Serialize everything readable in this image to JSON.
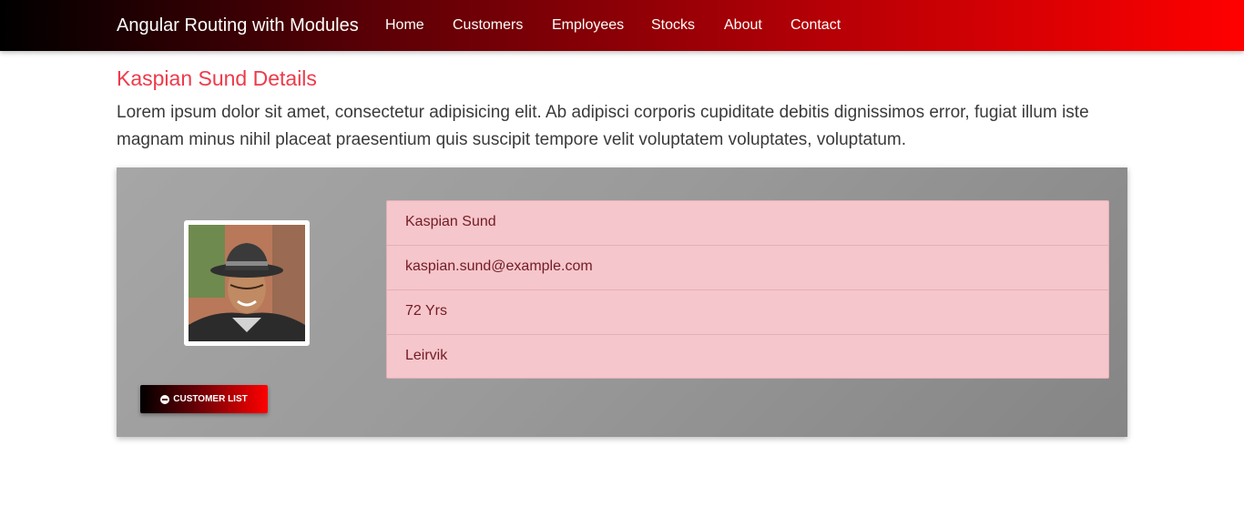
{
  "navbar": {
    "brand": "Angular Routing with Modules",
    "items": [
      {
        "label": "Home"
      },
      {
        "label": "Customers"
      },
      {
        "label": "Employees"
      },
      {
        "label": "Stocks"
      },
      {
        "label": "About"
      },
      {
        "label": "Contact"
      }
    ]
  },
  "page": {
    "title": "Kaspian Sund Details",
    "description": "Lorem ipsum dolor sit amet, consectetur adipisicing elit. Ab adipisci corporis cupiditate debitis dignissimos error, fugiat illum iste magnam minus nihil placeat praesentium quis suscipit tempore velit voluptatem voluptates, voluptatum."
  },
  "customer": {
    "name": "Kaspian Sund",
    "email": "kaspian.sund@example.com",
    "age": "72 Yrs",
    "city": "Leirvik"
  },
  "actions": {
    "back_label": "CUSTOMER LIST",
    "back_icon": "arrow-circle-left-icon"
  },
  "colors": {
    "accent": "#ee3a4a",
    "navbar_start": "#000000",
    "navbar_end": "#ff0000",
    "list_bg": "#f5c6cb",
    "list_text": "#721c24"
  }
}
